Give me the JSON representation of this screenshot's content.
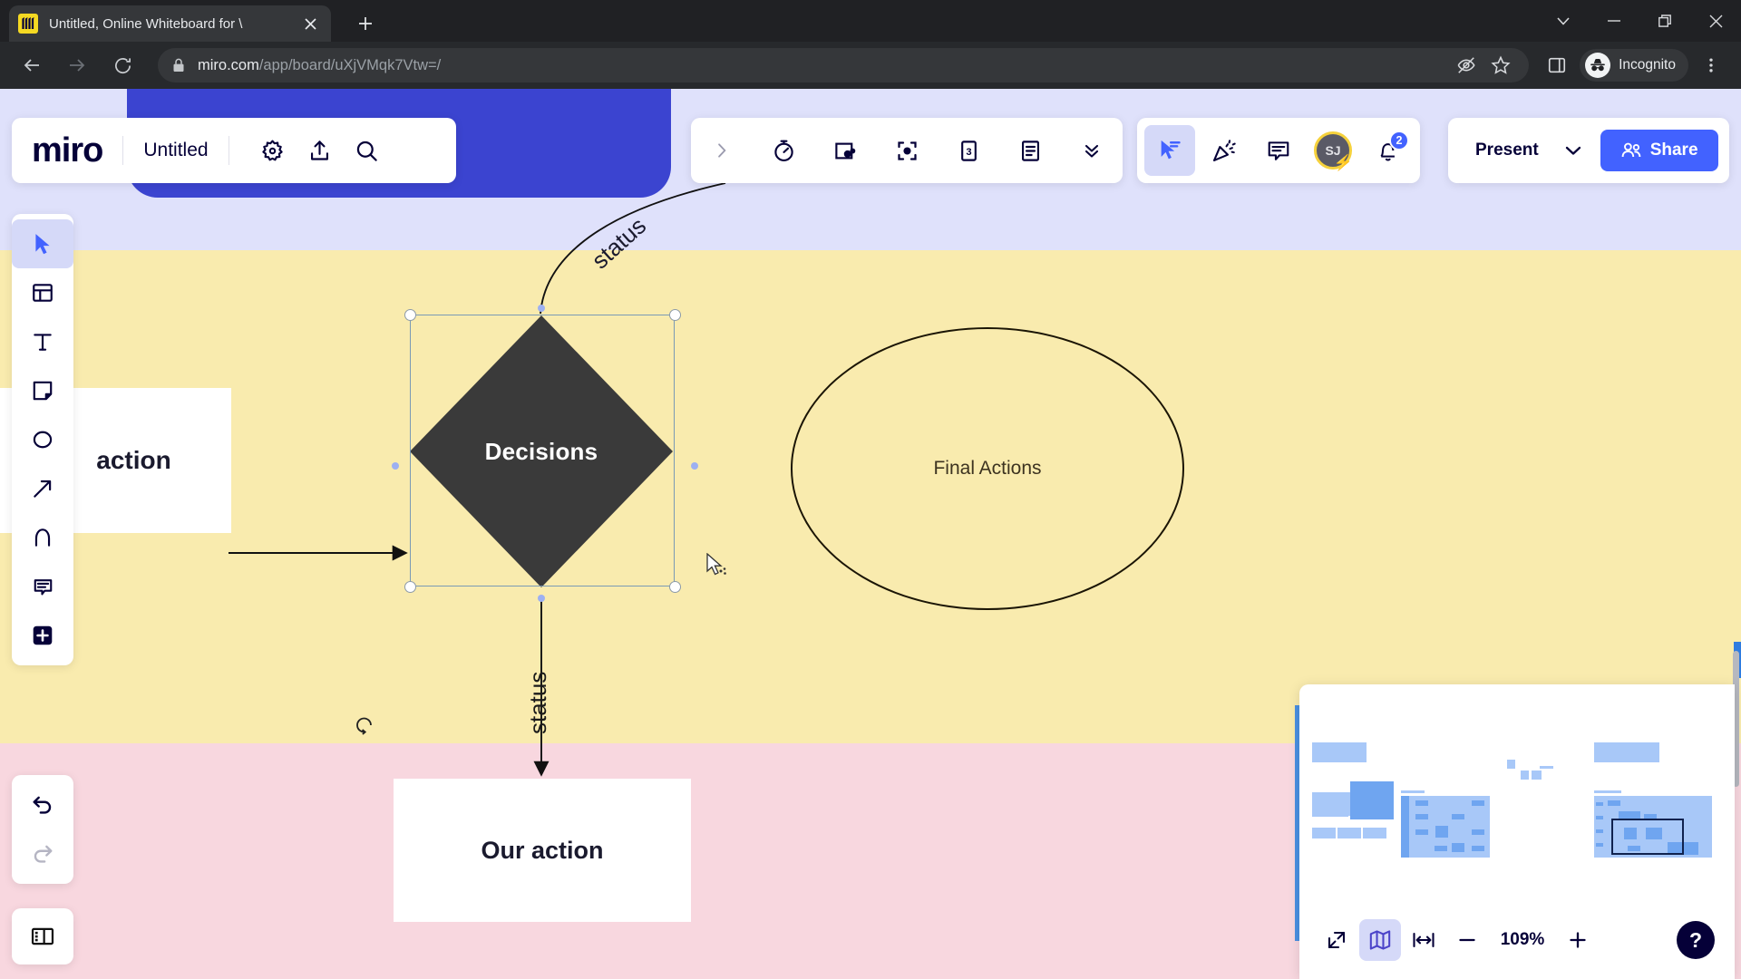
{
  "browser": {
    "tab": {
      "title": "Untitled, Online Whiteboard for \\",
      "favicon": "miro-favicon",
      "close": "✕"
    },
    "new_tab": "+",
    "window_controls": [
      {
        "name": "tab-search-chevron",
        "glyph": "chevron-down"
      },
      {
        "name": "minimize",
        "glyph": "minimize"
      },
      {
        "name": "maximize",
        "glyph": "restore"
      },
      {
        "name": "close",
        "glyph": "close"
      }
    ],
    "nav": {
      "back": "back-arrow",
      "forward": "forward-arrow",
      "reload": "reload"
    },
    "address": {
      "lock": "lock-icon",
      "domain": "miro.com",
      "path": "/app/board/uXjVMqk7Vtw=/"
    },
    "omnibox_icons": [
      {
        "name": "tracking-protection-icon",
        "glyph": "eye-slash"
      },
      {
        "name": "bookmark-icon",
        "glyph": "star"
      }
    ],
    "toolbar_icons": [
      {
        "name": "side-panel-icon",
        "glyph": "panel"
      }
    ],
    "profile": {
      "label": "Incognito",
      "icon": "incognito-icon"
    },
    "menu": "three-dot-menu"
  },
  "miro": {
    "logo": "miro",
    "board_title": "Untitled",
    "header_icons": [
      {
        "name": "settings-gear-icon",
        "glyph": "gear"
      },
      {
        "name": "export-upload-icon",
        "glyph": "upload"
      },
      {
        "name": "search-icon",
        "glyph": "search"
      }
    ],
    "center_toolbar": [
      {
        "name": "expand-toolbar-chevron",
        "glyph": "chevron-right"
      },
      {
        "name": "timer-icon",
        "glyph": "timer"
      },
      {
        "name": "voting-icon",
        "glyph": "voting"
      },
      {
        "name": "focus-mode-icon",
        "glyph": "focus"
      },
      {
        "name": "cards-icon",
        "glyph": "cards-3"
      },
      {
        "name": "notes-icon",
        "glyph": "notes"
      },
      {
        "name": "collapse-toolbar-icon",
        "glyph": "double-chevron-down"
      }
    ],
    "right_toolbar": [
      {
        "name": "cursor-chat-icon",
        "glyph": "cursor-chat",
        "active": true
      },
      {
        "name": "reactions-icon",
        "glyph": "party-popper",
        "active": false
      },
      {
        "name": "comments-icon",
        "glyph": "comment",
        "active": false
      }
    ],
    "avatar": {
      "initials": "SJ",
      "ring": "#f5d13c",
      "bolt": "⚡"
    },
    "notifications": {
      "icon": "bell-icon",
      "count": "2",
      "color": "#4262ff"
    },
    "present": {
      "label": "Present",
      "caret": "chevron-down"
    },
    "share": {
      "label": "Share",
      "icon": "people-icon",
      "color": "#4262ff"
    },
    "left_tools": [
      {
        "name": "select-tool",
        "glyph": "cursor",
        "active": true
      },
      {
        "name": "templates-tool",
        "glyph": "template",
        "active": false
      },
      {
        "name": "text-tool",
        "glyph": "T",
        "active": false
      },
      {
        "name": "sticky-note-tool",
        "glyph": "sticky",
        "active": false
      },
      {
        "name": "shapes-tool",
        "glyph": "circle",
        "active": false
      },
      {
        "name": "connector-tool",
        "glyph": "arrow",
        "active": false
      },
      {
        "name": "pen-tool",
        "glyph": "pen",
        "active": false
      },
      {
        "name": "comment-tool",
        "glyph": "comment",
        "active": false
      },
      {
        "name": "more-apps-tool",
        "glyph": "plus-square",
        "active": false
      }
    ],
    "history_tools": [
      {
        "name": "undo-button",
        "glyph": "undo",
        "enabled": true
      },
      {
        "name": "redo-button",
        "glyph": "redo",
        "enabled": false
      }
    ],
    "panel_toggle": {
      "name": "panel-toggle-button",
      "glyph": "panel"
    },
    "minimap": {
      "fit_screen": "fit-to-screen-icon",
      "map": "minimap-icon",
      "fit_width": "fit-width-icon",
      "zoom_out": "−",
      "zoom_level": "109%",
      "zoom_in": "+",
      "help": "?"
    }
  },
  "board": {
    "shapes": [
      {
        "name": "sticky-left",
        "text": "action",
        "type": "rectangle"
      },
      {
        "name": "decision-diamond",
        "text": "Decisions",
        "type": "diamond",
        "fill": "#3a3a3a",
        "selected": true
      },
      {
        "name": "final-actions-ellipse",
        "text": "Final Actions",
        "type": "ellipse"
      },
      {
        "name": "our-action-box",
        "text": "Our action",
        "type": "rectangle"
      }
    ],
    "connectors": [
      {
        "name": "connector-top",
        "label": "status"
      },
      {
        "name": "connector-bottom",
        "label": "status"
      }
    ],
    "bands": [
      {
        "name": "band-blue",
        "color": "#dfe1fb"
      },
      {
        "name": "band-yellow",
        "color": "#f9ebae"
      },
      {
        "name": "band-pink",
        "color": "#f8d7df"
      }
    ],
    "frame_blue": {
      "name": "blue-frame",
      "color": "#3b44d0"
    }
  }
}
